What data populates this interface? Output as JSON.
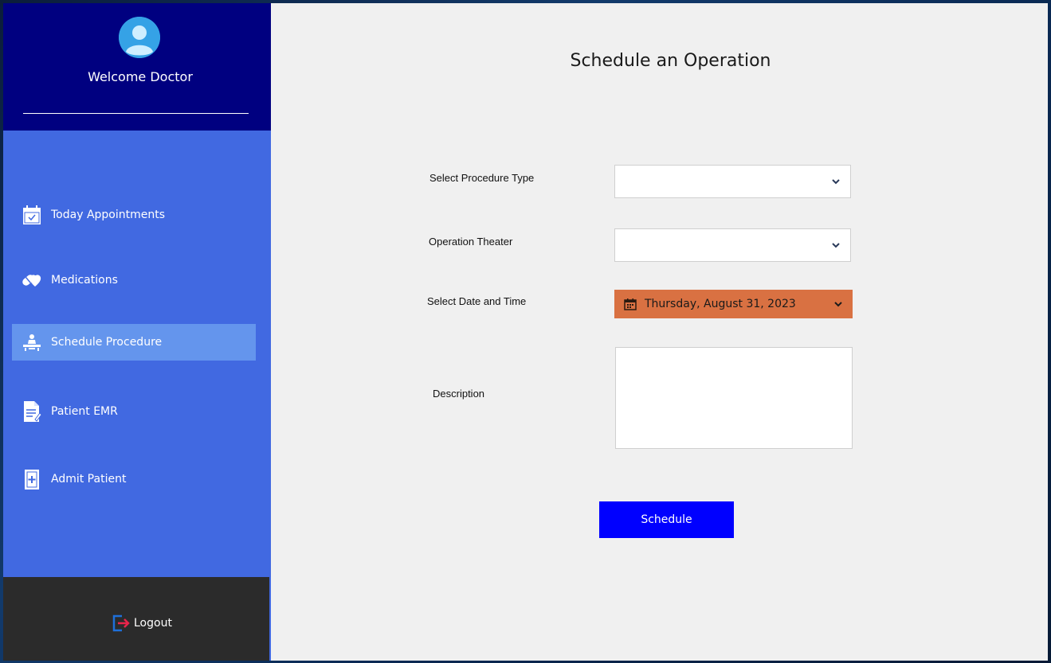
{
  "sidebar": {
    "welcome": "Welcome Doctor",
    "items": [
      {
        "label": "Today Appointments",
        "icon": "calendar-check-icon"
      },
      {
        "label": "Medications",
        "icon": "pills-icon"
      },
      {
        "label": "Schedule Procedure",
        "icon": "surgery-icon",
        "active": true
      },
      {
        "label": "Patient EMR",
        "icon": "document-icon"
      },
      {
        "label": "Admit Patient",
        "icon": "medical-clipboard-icon"
      }
    ],
    "logout": "Logout"
  },
  "main": {
    "title": "Schedule an Operation",
    "fields": {
      "procedure_type": {
        "label": "Select Procedure Type",
        "value": ""
      },
      "operation_theater": {
        "label": "Operation Theater",
        "value": ""
      },
      "date_time": {
        "label": "Select Date and Time",
        "value": "Thursday, August 31, 2023"
      },
      "description": {
        "label": "Description",
        "value": ""
      }
    },
    "schedule_button": "Schedule"
  },
  "colors": {
    "sidebar_header": "#000080",
    "sidebar": "#4169e1",
    "active_item": "#6495ed",
    "logout_bg": "#2b2b2b",
    "datepicker": "#d97142",
    "schedule_button": "#0000ff"
  }
}
